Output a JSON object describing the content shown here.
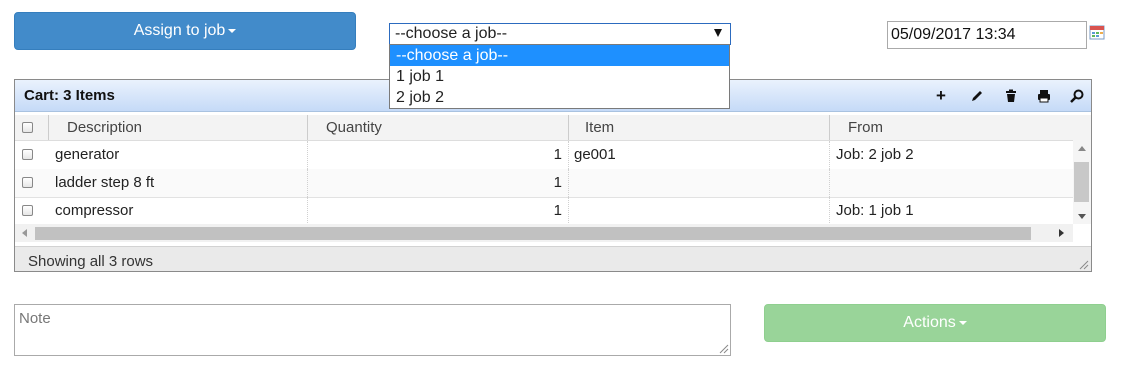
{
  "toolbar": {
    "assign_label": "Assign to job"
  },
  "job_select": {
    "value": "--choose a job--",
    "options": [
      "--choose a job--",
      "1 job 1",
      "2 job 2"
    ]
  },
  "date": {
    "value": "05/09/2017 13:34"
  },
  "cart": {
    "title": "Cart: 3 Items",
    "tools": [
      "add-icon",
      "edit-icon",
      "delete-icon",
      "print-icon",
      "search-icon"
    ],
    "columns": [
      "Description",
      "Quantity",
      "Item",
      "From"
    ],
    "rows": [
      {
        "description": "generator",
        "quantity": "1",
        "item": "ge001",
        "from": "Job: 2 job 2"
      },
      {
        "description": "ladder step 8 ft",
        "quantity": "1",
        "item": "",
        "from": ""
      },
      {
        "description": "compressor",
        "quantity": "1",
        "item": "",
        "from": "Job: 1 job 1"
      }
    ],
    "footer": "Showing all 3 rows"
  },
  "note": {
    "placeholder": "Note"
  },
  "actions": {
    "label": "Actions"
  }
}
